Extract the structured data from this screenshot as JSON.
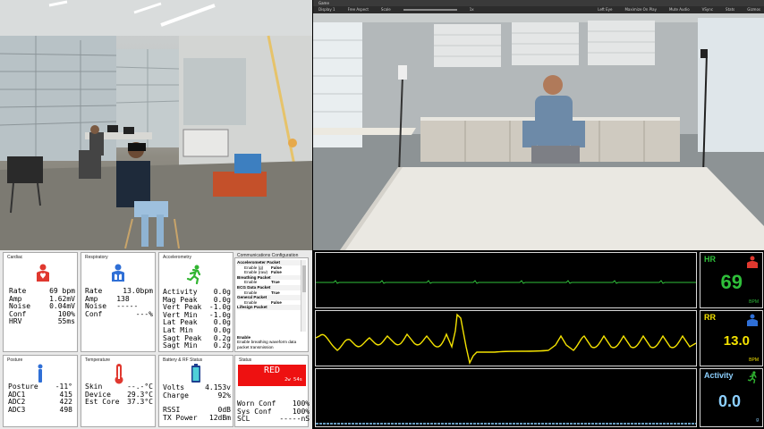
{
  "vr_window": {
    "title": "Game",
    "toolbar": [
      "Display 1",
      "Free Aspect",
      "Scale",
      "1x",
      "Left Eye",
      "Maximize On Play",
      "Mute Audio",
      "VSync",
      "Stats",
      "Gizmos"
    ]
  },
  "cardiac": {
    "title": "Cardiac",
    "rows": [
      [
        "Rate",
        "69 bpm"
      ],
      [
        "Amp",
        "1.62mV"
      ],
      [
        "Noise",
        "0.04mV"
      ],
      [
        "Conf",
        "100%"
      ],
      [
        "HRV",
        "55ms"
      ]
    ]
  },
  "respiratory": {
    "title": "Respiratory",
    "rows": [
      [
        "Rate",
        "13.0bpm"
      ],
      [
        "Amp",
        "138"
      ],
      [
        "Noise",
        "-----"
      ],
      [
        "Conf",
        "---%"
      ]
    ]
  },
  "accelerometry": {
    "title": "Accelerometry",
    "rows": [
      [
        "Activity",
        "0.0g"
      ],
      [
        "Mag Peak",
        "0.0g"
      ],
      [
        "Vert Peak",
        "-1.0g"
      ],
      [
        "Vert Min",
        "-1.0g"
      ],
      [
        "Lat Peak",
        "0.0g"
      ],
      [
        "Lat Min",
        "0.0g"
      ],
      [
        "Sagt Peak",
        "0.2g"
      ],
      [
        "Sagt Min",
        "0.2g"
      ]
    ]
  },
  "comm_config": {
    "title": "Communications Configuration",
    "groups": [
      {
        "name": "Accelerometer Packet",
        "rows": [
          [
            "Enable (g)",
            "False"
          ],
          [
            "Enable (raw)",
            "False"
          ]
        ]
      },
      {
        "name": "Breathing Packet",
        "rows": [
          [
            "Enable",
            "True"
          ]
        ]
      },
      {
        "name": "ECG Data Packet",
        "rows": [
          [
            "Enable",
            "True"
          ]
        ]
      },
      {
        "name": "General Packet",
        "rows": [
          [
            "Enable",
            "False"
          ]
        ]
      },
      {
        "name": "Lifesign Packet",
        "rows": []
      }
    ],
    "desc_title": "Enable",
    "desc_text": "Enable breathing waveform data packet transmission"
  },
  "posture": {
    "title": "Posture",
    "rows": [
      [
        "Posture",
        "-11°"
      ],
      [
        "ADC1",
        "415"
      ],
      [
        "ADC2",
        "422"
      ],
      [
        "ADC3",
        "498"
      ]
    ]
  },
  "temperature": {
    "title": "Temperature",
    "rows": [
      [
        "Skin",
        "--.-°C"
      ],
      [
        "Device",
        "29.3°C"
      ],
      [
        "Est Core",
        "37.3°C"
      ]
    ]
  },
  "battery": {
    "title": "Battery & RF Status",
    "rows1": [
      [
        "Volts",
        "4.153v"
      ],
      [
        "Charge",
        "92%"
      ]
    ],
    "rows2": [
      [
        "RSSI",
        "0dB"
      ],
      [
        "TX Power",
        "12dBm"
      ]
    ]
  },
  "status": {
    "title": "Status",
    "state": "RED",
    "timer": "2w 54s",
    "rows": [
      [
        "Worn Conf",
        "100%"
      ],
      [
        "Sys Conf",
        "100%"
      ],
      [
        "SCL",
        "-----nS"
      ]
    ]
  },
  "vitals": {
    "hr": {
      "label": "HR",
      "value": "69",
      "unit": "BPM",
      "color": "#2fbf3a"
    },
    "rr": {
      "label": "RR",
      "value": "13.0",
      "unit": "BPM",
      "color": "#f4e200"
    },
    "activity": {
      "label": "Activity",
      "value": "0.0",
      "unit": "g",
      "color": "#8cd0ff"
    }
  },
  "colors": {
    "alarm_red": "#ee1111",
    "ecg_green": "#2fbf3a",
    "resp_yellow": "#f4e200",
    "activity_blue": "#8cd0ff"
  }
}
